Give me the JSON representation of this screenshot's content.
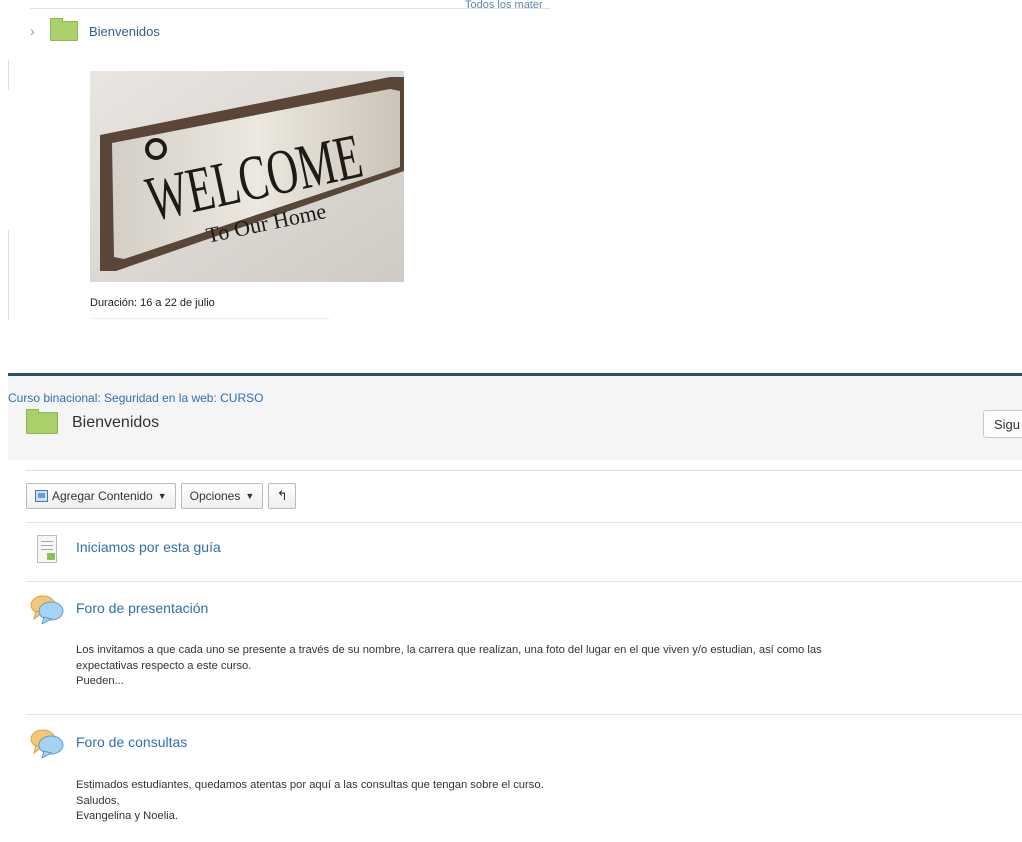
{
  "top_panel": {
    "cut_link_text": "Todos los mater",
    "tree_item_label": "Bienvenidos",
    "image_sign_text": {
      "line1": "WELCOME",
      "line2": "To Our Home"
    },
    "duration_text": "Duración: 16 a 22 de julio"
  },
  "bottom_panel": {
    "breadcrumb": "Curso binacional: Seguridad en la web: CURSO",
    "page_title": "Bienvenidos",
    "follow_button_label": "Sigu",
    "toolbar": {
      "add_content_label": "Agregar Contenido",
      "options_label": "Opciones",
      "undo_icon": "undo-arrow"
    },
    "items": [
      {
        "title": "Iniciamos por esta guía",
        "icon": "document-icon"
      },
      {
        "title": "Foro de presentación",
        "icon": "forum-icon",
        "description": [
          "Los invitamos a que cada uno se presente a través de su nombre, la carrera que realizan, una foto del lugar en el que viven y/o estudian, así como las",
          "expectativas respecto a este curso.",
          "Pueden..."
        ]
      },
      {
        "title": "Foro de consultas",
        "icon": "forum-icon",
        "description": [
          "Estimados estudiantes, quedamos atentas por aquí a las consultas que tengan sobre el curso.",
          "Saludos,",
          "Evangelina y Noelia."
        ]
      }
    ]
  },
  "colors": {
    "link": "#2f6fad",
    "folder": "#a9d06a",
    "header_border": "#2b506c"
  }
}
